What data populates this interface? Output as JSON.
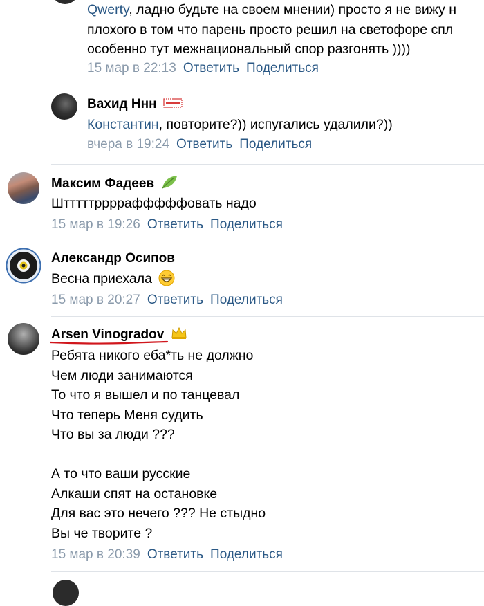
{
  "comments": [
    {
      "mention": "Qwerty",
      "lines": [
        ", ладно будьте на своем мнении) просто я не вижу н",
        "плохого в том что парень просто решил на светофоре спл",
        "особенно тут межнациональный спор разгонять ))))"
      ],
      "date": "15 мар в 22:13",
      "reply": "Ответить",
      "share": "Поделиться"
    },
    {
      "name": "Вахид Ннн",
      "mention": "Константин",
      "lines": [
        ", повторите?)) испугались удалили?))"
      ],
      "date": "вчера в 19:24",
      "reply": "Ответить",
      "share": "Поделиться"
    },
    {
      "name": "Максим Фадеев",
      "lines": [
        "Штттттррррафффффовать надо"
      ],
      "date": "15 мар в 19:26",
      "reply": "Ответить",
      "share": "Поделиться"
    },
    {
      "name": "Александр Осипов",
      "lines": [
        "Весна приехала"
      ],
      "date": "15 мар в 20:27",
      "reply": "Ответить",
      "share": "Поделиться"
    },
    {
      "name": "Arsen Vinogradov",
      "lines": [
        "Ребята никого еба*ть не должно",
        "Чем люди занимаются",
        "То что я вышел и по танцевал",
        "Что теперь Меня судить",
        "Что вы за люди ???",
        "",
        "А то что ваши русские",
        "Алкаши спят на остановке",
        "Для вас это нечего ??? Не стыдно",
        "Вы че творите ?"
      ],
      "date": "15 мар в 20:39",
      "reply": "Ответить",
      "share": "Поделиться"
    }
  ],
  "colors": {
    "link": "#2a5885",
    "meta": "#8a9aab",
    "divider": "#dfe3e8",
    "underline": "#d0161c"
  },
  "icons": [
    "sticker-badge-icon",
    "leaf-icon",
    "grin-emoji-icon",
    "crown-icon"
  ]
}
